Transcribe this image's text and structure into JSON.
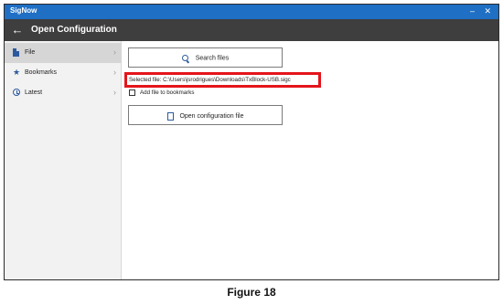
{
  "titlebar": {
    "app_name": "SigNow",
    "minimize": "–",
    "close": "✕"
  },
  "header": {
    "back_icon": "arrow-left-icon",
    "title": "Open Configuration"
  },
  "sidebar": {
    "items": [
      {
        "label": "File",
        "icon": "file-icon",
        "active": true
      },
      {
        "label": "Bookmarks",
        "icon": "star-icon",
        "active": false
      },
      {
        "label": "Latest",
        "icon": "clock-icon",
        "active": false
      }
    ]
  },
  "main": {
    "search_button": {
      "label": "Search files",
      "icon": "search-icon"
    },
    "selected_file": "Selected file: C:\\Users\\jsrodrigues\\Downloads\\TxBlock-USB.sigc",
    "add_bookmark": {
      "label": "Add file to bookmarks",
      "checked": false
    },
    "open_button": {
      "label": "Open configuration file",
      "icon": "document-icon"
    }
  },
  "caption": "Figure 18",
  "colors": {
    "titlebar": "#1f6fc4",
    "header": "#3e3e3e",
    "accent_icon": "#2c5aa0",
    "highlight": "#e4141b"
  }
}
